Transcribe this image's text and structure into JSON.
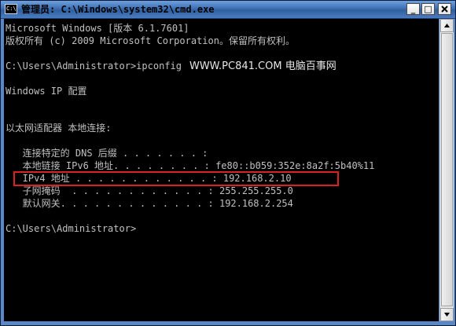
{
  "window": {
    "icon_text": "C:\\",
    "title": "管理员: C:\\Windows\\system32\\cmd.exe",
    "minimize_label": "_",
    "maximize_label": "□"
  },
  "console": {
    "lines": [
      "Microsoft Windows [版本 6.1.7601]",
      "版权所有 (c) 2009 Microsoft Corporation。保留所有权利。",
      "",
      "C:\\Users\\Administrator>ipconfig",
      "",
      "Windows IP 配置",
      "",
      "",
      "以太网适配器 本地连接:",
      "",
      "   连接特定的 DNS 后缀 . . . . . . . :",
      "   本地链接 IPv6 地址. . . . . . . . : fe80::b059:352e:8a2f:5b40%11",
      "   IPv4 地址 . . . . . . . . . . . . : 192.168.2.10",
      "   子网掩码  . . . . . . . . . . . . : 255.255.255.0",
      "   默认网关. . . . . . . . . . . . . : 192.168.2.254",
      "",
      "C:\\Users\\Administrator>"
    ],
    "watermark": "WWW.PC841.COM 电脑百事网"
  },
  "colors": {
    "console_bg": "#000000",
    "console_text": "#c0c0c0",
    "highlight_border": "#d92222",
    "titlebar": "#3e6fb4"
  }
}
